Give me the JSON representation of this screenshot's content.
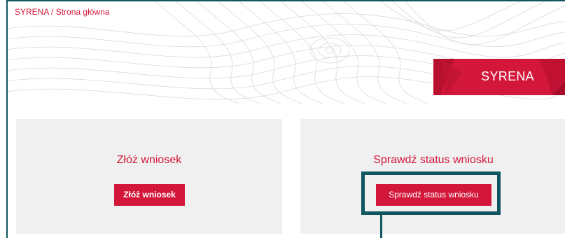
{
  "breadcrumb": {
    "root": "SYRENA",
    "separator": "/",
    "current": "Strona główna"
  },
  "banner": {
    "title": "SYRENA"
  },
  "cards": {
    "submit": {
      "title": "Złóż wniosek",
      "button": "Złóż wniosek"
    },
    "status": {
      "title": "Sprawdź status wniosku",
      "button": "Sprawdź status wniosku"
    }
  },
  "colors": {
    "brand": "#d3173a",
    "annotation": "#0f5660",
    "card_bg": "#f0f0f0"
  }
}
